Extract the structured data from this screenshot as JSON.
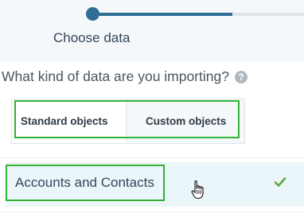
{
  "wizard": {
    "step_label": "Choose data",
    "progress_percent": 66,
    "accent_color": "#2d6e93"
  },
  "question": {
    "text": "What kind of data are you importing?",
    "help_icon": "?"
  },
  "tabs": [
    {
      "label": "Standard objects",
      "active": true
    },
    {
      "label": "Custom objects",
      "active": false
    }
  ],
  "options": [
    {
      "label": "Accounts and Contacts",
      "selected": true,
      "check_icon": "checkmark-icon"
    }
  ],
  "highlight_color": "#34b233"
}
